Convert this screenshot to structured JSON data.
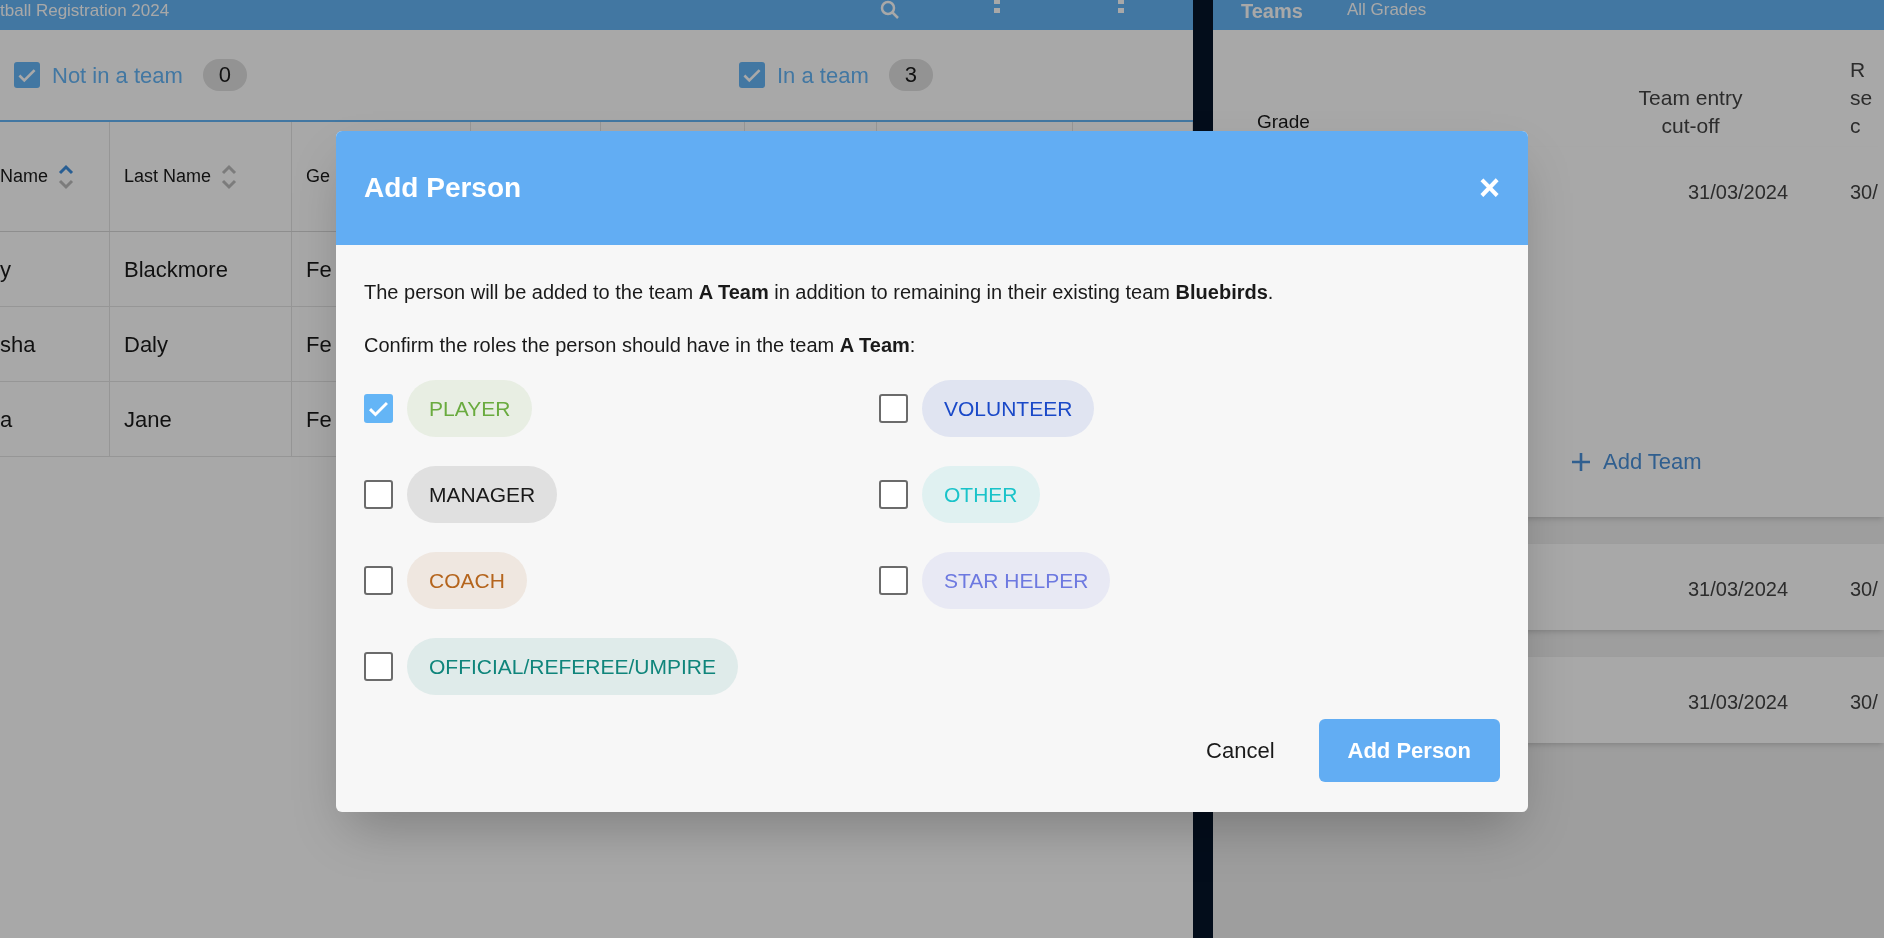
{
  "left_panel": {
    "title": "tball Registration 2024",
    "filters": [
      {
        "label": "Not in a team",
        "count": "0",
        "checked": true
      },
      {
        "label": "In a team",
        "count": "3",
        "checked": true
      }
    ],
    "table": {
      "columns": [
        {
          "label": "Name",
          "kind": "sortable",
          "sorted": true
        },
        {
          "label": "Last Name",
          "kind": "sortable",
          "sorted": false
        },
        {
          "label": "Ge",
          "kind": "plain"
        }
      ],
      "rows": [
        [
          "y",
          "Blackmore",
          "Fe"
        ],
        [
          "sha",
          "Daly",
          "Fe"
        ],
        [
          "a",
          "Jane",
          "Fe"
        ]
      ]
    }
  },
  "right_panel": {
    "title": "Teams",
    "subtitle": "All Grades",
    "columns": [
      "Grade",
      "Team entry cut-off",
      "R se c"
    ],
    "cards": [
      {
        "cut_off": "31/03/2024",
        "column_3": "30/",
        "action": "Add Team"
      },
      {
        "cut_off": "31/03/2024",
        "column_3": "30/"
      },
      {
        "cut_off": "31/03/2024",
        "column_3": "30/"
      }
    ]
  },
  "dialog": {
    "title": "Add Person",
    "close": "×",
    "message": "The person will be added to the team **A Team** in addition to remaining in their existing team **Bluebirds**.",
    "prompt": "Confirm the roles the person should have in the team **A Team**:",
    "roles": [
      {
        "label": "PLAYER",
        "checked": true,
        "color": "#6aab3f"
      },
      {
        "label": "VOLUNTEER",
        "checked": false,
        "color": "#1a49c8"
      },
      {
        "label": "MANAGER",
        "checked": false,
        "color": "#1a1a1a"
      },
      {
        "label": "OTHER",
        "checked": false,
        "color": "#19c3c9"
      },
      {
        "label": "COACH",
        "checked": false,
        "color": "#b5651d"
      },
      {
        "label": "STAR HELPER",
        "checked": false,
        "color": "#6d79e0"
      },
      {
        "label": "OFFICIAL/REFEREE/UMPIRE",
        "checked": false,
        "color": "#0f857b"
      }
    ],
    "buttons": [
      {
        "label": "Cancel",
        "kind": "text"
      },
      {
        "label": "Add Person",
        "kind": "primary"
      }
    ]
  }
}
